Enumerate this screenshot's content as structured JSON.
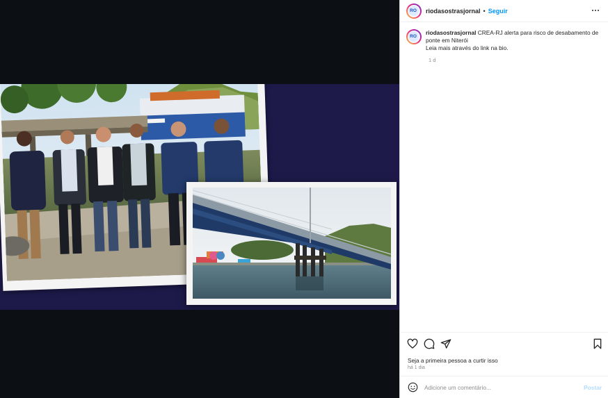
{
  "post": {
    "username": "riodasostrasjornal",
    "follow_label": "Seguir",
    "separator": "•",
    "caption_username": "riodasostrasjornal",
    "caption_line1": "CREA-RJ alerta para risco de desabamento de ponte em Niterói",
    "caption_line2": "Leia mais através do link na bio.",
    "caption_age": "1 d",
    "likes_text": "Seja a primeira pessoa a",
    "likes_link": "curtir isso",
    "date_text": "há 1 dia",
    "comment_placeholder": "Adicione um comentário...",
    "post_button": "Postar"
  },
  "avatar_logo_text": "RO",
  "colors": {
    "accent": "#0095f6",
    "post_disabled": "#b3dbff",
    "media_background": "#0c1014",
    "collage_background": "#1d1a4a"
  },
  "icons": {
    "more": "more-horizontal-icon",
    "like": "heart-icon",
    "comment": "comment-icon",
    "share": "send-icon",
    "save": "bookmark-icon",
    "emoji": "emoji-icon"
  }
}
